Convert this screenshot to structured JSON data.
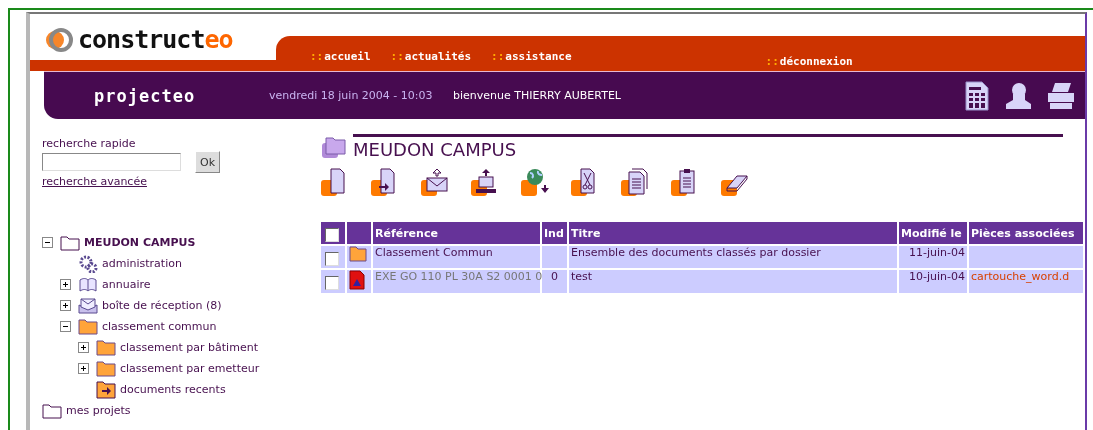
{
  "logo": {
    "text": "construct",
    "accent": "eo"
  },
  "nav": [
    {
      "label": "accueil"
    },
    {
      "label": "actualités"
    },
    {
      "label": "assistance"
    }
  ],
  "logout": {
    "label": "déconnexion"
  },
  "nav_bullet": "::",
  "banner": {
    "app": "projecteo",
    "date": "vendredi 18 juin 2004 - 10:03",
    "welcome": "bienvenue THIERRY AUBERTEL"
  },
  "search": {
    "label": "recherche rapide",
    "button": "Ok",
    "advanced": "recherche avancée"
  },
  "tree": [
    {
      "label": "MEUDON CAMPUS",
      "kind": "outline-folder",
      "expanded": true,
      "bold": true,
      "children": [
        {
          "label": "administration",
          "kind": "gear"
        },
        {
          "label": "annuaire",
          "kind": "book",
          "expanded": false
        },
        {
          "label": "boîte de réception (8)",
          "kind": "inbox",
          "expanded": false
        },
        {
          "label": "classement commun",
          "kind": "folder",
          "expanded": true,
          "children": [
            {
              "label": "classement par bâtiment",
              "kind": "folder",
              "expanded": false
            },
            {
              "label": "classement par emetteur",
              "kind": "folder",
              "expanded": false
            },
            {
              "label": "documents recents",
              "kind": "arrow-folder"
            }
          ]
        }
      ]
    },
    {
      "label": "mes projets",
      "kind": "outline-folder",
      "bold": false
    }
  ],
  "folder_title": "MEUDON CAMPUS",
  "table": {
    "all_checked": false,
    "columns": [
      "Référence",
      "Ind",
      "Titre",
      "Modifié le",
      "Pièces associées"
    ],
    "rows": [
      {
        "kind": "folder",
        "checked": false,
        "reference": "Classement Commun",
        "ind": "",
        "title": "Ensemble des documents classés par dossier",
        "modified": "11-juin-04",
        "attachment": ""
      },
      {
        "kind": "document",
        "checked": false,
        "reference": "EXE GO 110 PL 30A S2 0001 0",
        "ind": "0",
        "title": "test",
        "modified": "10-juin-04",
        "attachment": "cartouche_word.d"
      }
    ]
  }
}
